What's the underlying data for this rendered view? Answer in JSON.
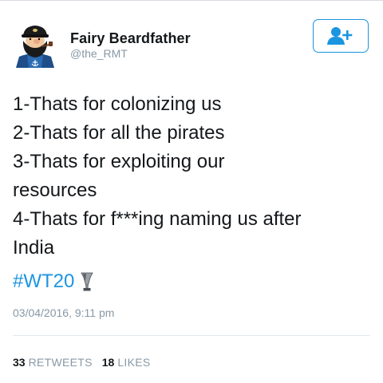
{
  "user": {
    "display_name": "Fairy Beardfather",
    "handle": "@the_RMT"
  },
  "follow_button": {
    "icon": "add-user-icon"
  },
  "tweet": {
    "lines": [
      "1-Thats for colonizing us",
      "2-Thats for all the pirates",
      "3-Thats for exploiting our",
      "resources",
      "4-Thats for f***ing naming us after",
      "India"
    ],
    "hashtag": "#WT20",
    "emoji": "trophy-icon",
    "timestamp": "03/04/2016, 9:11 pm"
  },
  "stats": {
    "retweets_count": "33",
    "retweets_label": "RETWEETS",
    "likes_count": "18",
    "likes_label": "LIKES"
  },
  "colors": {
    "accent": "#1b95e0",
    "muted": "#8899a6",
    "text": "#14171a"
  }
}
